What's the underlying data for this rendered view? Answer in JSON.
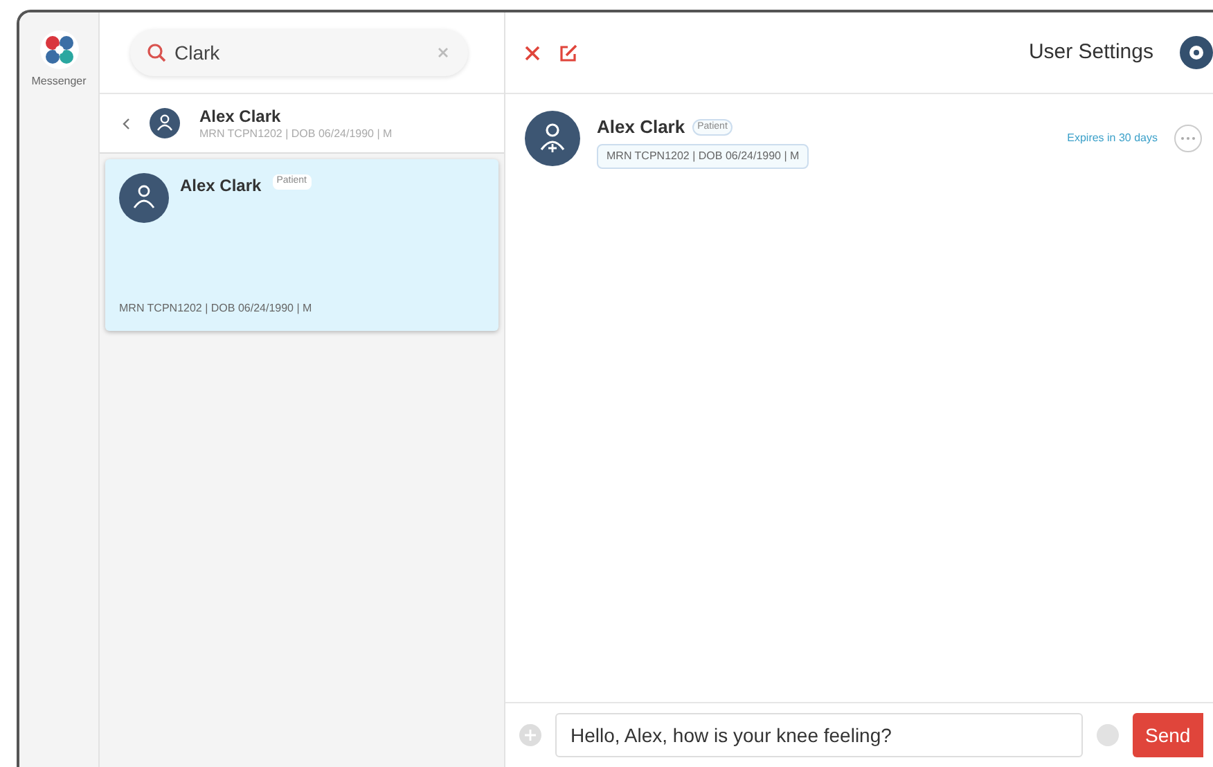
{
  "app": {
    "name": "Messenger"
  },
  "search": {
    "value": "Clark"
  },
  "header": {
    "user_settings": "User Settings"
  },
  "current_contact": {
    "name": "Alex Clark",
    "details": "MRN TCPN1202 | DOB 06/24/1990 | M"
  },
  "results": [
    {
      "name": "Alex Clark",
      "badge": "Patient",
      "details": "MRN TCPN1202 | DOB 06/24/1990 | M",
      "selected": true
    }
  ],
  "conversation": {
    "name": "Alex Clark",
    "badge": "Patient",
    "details": "MRN TCPN1202 | DOB 06/24/1990 | M",
    "expiry": "Expires in 30 days"
  },
  "composer": {
    "value": "Hello, Alex, how is your knee feeling?",
    "send": "Send"
  }
}
